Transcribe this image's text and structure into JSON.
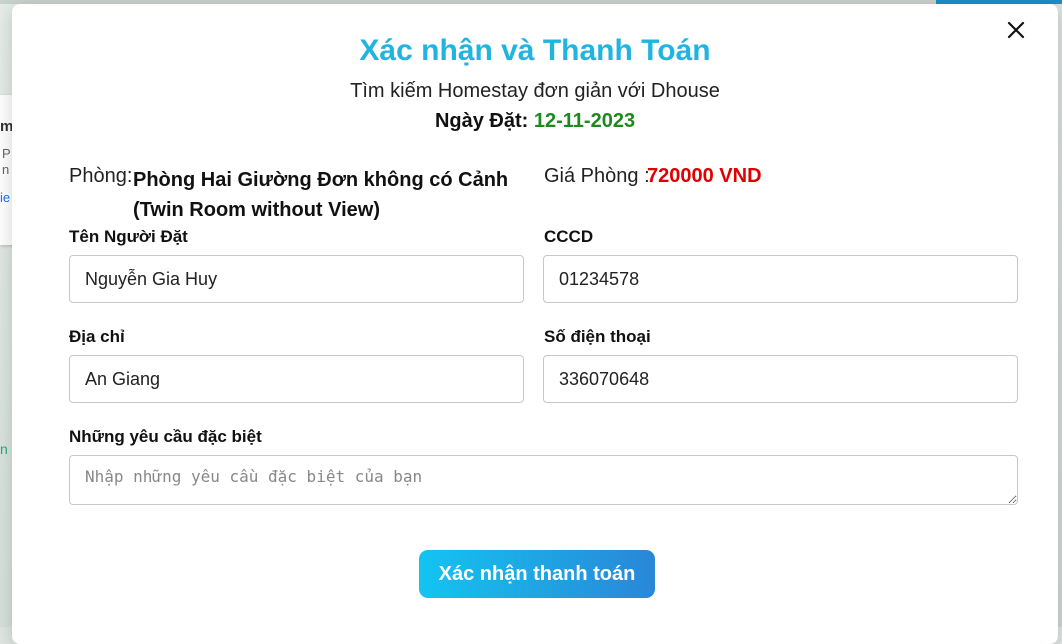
{
  "background": {
    "fragments": [
      "m",
      "P",
      "n Đ",
      "ie",
      "n"
    ],
    "accent_color": "#1b8fc9"
  },
  "modal": {
    "close_icon": "close-icon",
    "title": "Xác nhận và Thanh Toán",
    "subtitle": "Tìm kiếm Homestay đơn giản với Dhouse",
    "date_label": "Ngày Đặt:",
    "date_value": "12-11-2023",
    "room_label": "Phòng:",
    "room_value": "Phòng Hai Giường Đơn không có Cảnh (Twin Room without View)",
    "price_label": "Giá Phòng :",
    "price_value": "720000 VND",
    "fields": {
      "name": {
        "label": "Tên Người Đặt",
        "value": "Nguyễn Gia Huy"
      },
      "cccd": {
        "label": "CCCD",
        "value": "01234578"
      },
      "address": {
        "label": "Địa chỉ",
        "value": "An Giang"
      },
      "phone": {
        "label": "Số điện thoại",
        "value": "336070648"
      },
      "requests": {
        "label": "Những yêu cầu đặc biệt",
        "placeholder": "Nhập những yêu cầu đặc biệt của bạn",
        "value": ""
      }
    },
    "submit_label": "Xác nhận thanh toán"
  },
  "colors": {
    "title": "#22b4e0",
    "date": "#1e8a1e",
    "price": "#e00000",
    "button_start": "#13c4f0",
    "button_end": "#2a86d8"
  }
}
